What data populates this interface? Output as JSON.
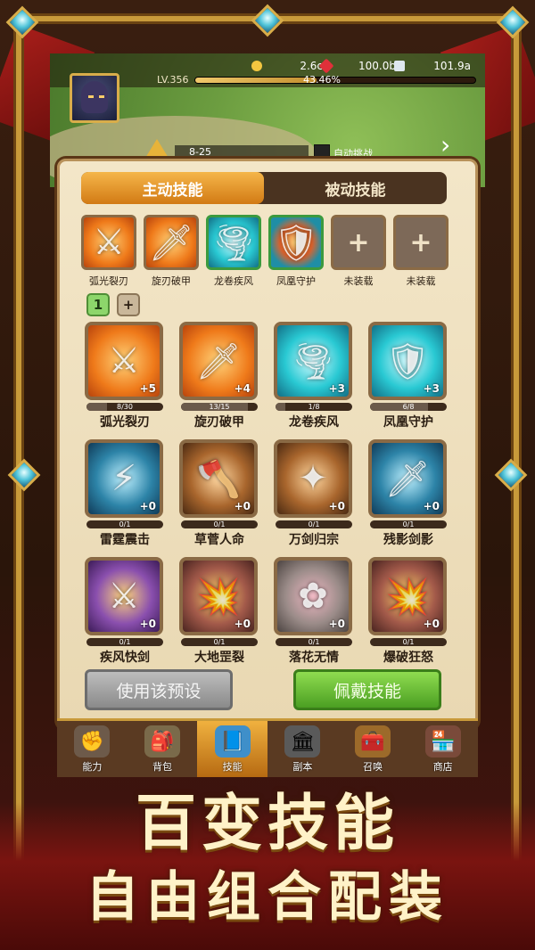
{
  "resources": {
    "gold": "2.6c",
    "ruby": "100.0b",
    "gem": "101.9a"
  },
  "player": {
    "level": "LV.356",
    "exp_percent": "43.46%",
    "exp_fraction": 0.4346
  },
  "stage": {
    "label": "8-25",
    "auto_battle": "自动挑战"
  },
  "tabs": {
    "active": "主动技能",
    "passive": "被动技能"
  },
  "equipped": [
    {
      "label": "弧光裂刃"
    },
    {
      "label": "旋刃破甲"
    },
    {
      "label": "龙卷疾风"
    },
    {
      "label": "凤凰守护"
    },
    {
      "label": "未装载"
    },
    {
      "label": "未装载"
    }
  ],
  "preset": {
    "current": "1",
    "add": "+"
  },
  "skills": [
    {
      "name": "弧光裂刃",
      "progress": "8/30",
      "plus": "+5",
      "fill": 0.27,
      "icon": "arc-sword-icon"
    },
    {
      "name": "旋刃破甲",
      "progress": "13/15",
      "plus": "+4",
      "fill": 0.87,
      "icon": "spin-blade-icon"
    },
    {
      "name": "龙卷疾风",
      "progress": "1/8",
      "plus": "+3",
      "fill": 0.13,
      "icon": "tornado-icon"
    },
    {
      "name": "凤凰守护",
      "progress": "6/8",
      "plus": "+3",
      "fill": 0.75,
      "icon": "phoenix-shield-icon"
    },
    {
      "name": "雷霆震击",
      "progress": "0/1",
      "plus": "+0",
      "fill": 0,
      "icon": "thunder-icon"
    },
    {
      "name": "草菅人命",
      "progress": "0/1",
      "plus": "+0",
      "fill": 0,
      "icon": "scarecrow-icon"
    },
    {
      "name": "万剑归宗",
      "progress": "0/1",
      "plus": "+0",
      "fill": 0,
      "icon": "swords-icon"
    },
    {
      "name": "残影剑影",
      "progress": "0/1",
      "plus": "+0",
      "fill": 0,
      "icon": "shadow-blade-icon"
    },
    {
      "name": "疾风快剑",
      "progress": "0/1",
      "plus": "+0",
      "fill": 0,
      "icon": "wind-sword-icon"
    },
    {
      "name": "大地罡裂",
      "progress": "0/1",
      "plus": "+0",
      "fill": 0,
      "icon": "earth-crack-icon"
    },
    {
      "name": "落花无情",
      "progress": "0/1",
      "plus": "+0",
      "fill": 0,
      "icon": "flower-icon"
    },
    {
      "name": "爆破狂怒",
      "progress": "0/1",
      "plus": "+0",
      "fill": 0,
      "icon": "explosion-icon"
    }
  ],
  "buttons": {
    "use_preset": "使用该预设",
    "equip": "佩戴技能"
  },
  "nav": [
    {
      "label": "能力",
      "icon": "fist-icon"
    },
    {
      "label": "背包",
      "icon": "backpack-icon"
    },
    {
      "label": "技能",
      "icon": "skill-book-icon"
    },
    {
      "label": "副本",
      "icon": "dungeon-gate-icon"
    },
    {
      "label": "召唤",
      "icon": "treasure-chest-icon"
    },
    {
      "label": "商店",
      "icon": "shop-icon"
    }
  ],
  "promo": {
    "line1": "百变技能",
    "line2": "自由组合配装"
  },
  "colors": {
    "accent_orange": "#ef7a1a",
    "accent_green": "#4b9f22",
    "frame_gold": "#c89a3a",
    "panel_bg": "#f3e6c8"
  }
}
